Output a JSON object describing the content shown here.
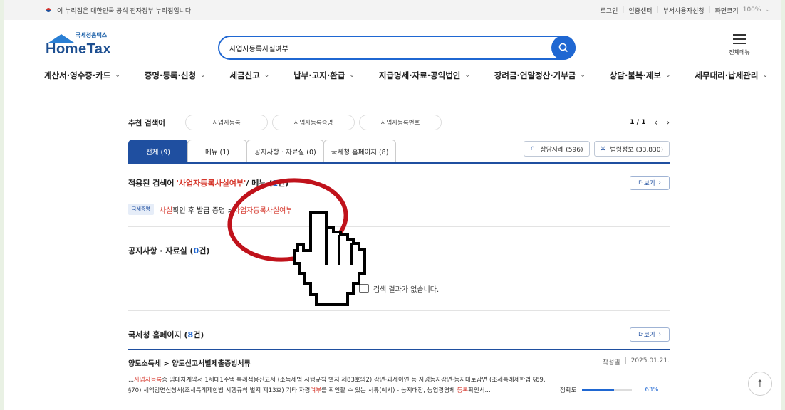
{
  "gov_bar": {
    "notice": "이 누리집은 대한민국 공식 전자정부 누리집입니다.",
    "links": [
      "로그인",
      "인증센터",
      "부서사용자신청"
    ],
    "zoom_label": "화면크기",
    "zoom_value": "100%"
  },
  "header": {
    "logo_small": "국세청홈택스",
    "logo_big": "HomeTax",
    "search_value": "사업자등록사실여부",
    "all_menu_label": "전체메뉴"
  },
  "nav": [
    {
      "label": "계산서·영수증·카드"
    },
    {
      "label": "증명·등록·신청"
    },
    {
      "label": "세금신고"
    },
    {
      "label": "납부·고지·환급"
    },
    {
      "label": "지급명세·자료·공익법인"
    },
    {
      "label": "장려금·연말정산·기부금"
    },
    {
      "label": "상담·불복·제보"
    },
    {
      "label": "세무대리·납세관리"
    }
  ],
  "recommend": {
    "label": "추천 검색어",
    "chips": [
      "사업자등록",
      "사업자등록증명",
      "사업자등록번호"
    ],
    "page": "1 / 1"
  },
  "tabs": [
    {
      "label": "전체 (9)",
      "active": true
    },
    {
      "label": "메뉴 (1)"
    },
    {
      "label": "공지사항 · 자료실 (0)"
    },
    {
      "label": "국세청 홈페이지 (8)"
    }
  ],
  "side_buttons": {
    "consult": "상담사례 (596)",
    "law": "법령정보 (33,830)"
  },
  "applied": {
    "prefix": "적용된 검색어 ",
    "term": "'사업자등록사실여부'",
    "mid": " / 메뉴 (",
    "count": "1",
    "suffix": "건)",
    "more": "더보기"
  },
  "menu_result": {
    "tag": "국세증명",
    "part1_red": "사실",
    "part2": "확인 후 발급 증명 > ",
    "part3_red": "사업자등록사실여부"
  },
  "notice_section": {
    "title_prefix": "공지사항 · 자료실 (",
    "count": "0",
    "title_suffix": "건)",
    "empty_text": "검색 결과가 없습니다."
  },
  "homepage_section": {
    "title_prefix": "국세청 홈페이지 (",
    "count": "8",
    "title_suffix": "건)",
    "more": "더보기",
    "result": {
      "title": "양도소득세 > 양도신고서별제출증빙서류",
      "date_label": "작성일",
      "date": "2025.01.21.",
      "text_a": "...",
      "text_b_red": "사업자등록",
      "text_c": "증 임대차계약서 1세대1주택 특례적용신고서 (소득세법 시행규칙 별지 제83호의2) 감면·과세이연 등 자경농지감면·농지대토감면 (조세특례제한법 §69, §70) 세액감면신청서(조세특례제한법 시행규칙 별지 제13호) 기타 자경",
      "text_d_red": "여부",
      "text_e": "를 확인할 수 있는 서류(예시) - 농지대장, 농업경영체 ",
      "text_f_red": "등록",
      "text_g": "확인서...",
      "accuracy_label": "정확도",
      "accuracy_pct": "63%",
      "accuracy_value": 0.63
    }
  },
  "colors": {
    "primary": "#1f4fa0",
    "accent": "#1f67d2",
    "highlight": "#d6392e",
    "annotation_circle": "#c0121b"
  },
  "icons": [
    "search-icon",
    "menu-icon",
    "chevron-down-icon",
    "headset-icon",
    "gavel-icon",
    "document-icon",
    "arrow-up-icon",
    "hand-pointer-icon"
  ]
}
